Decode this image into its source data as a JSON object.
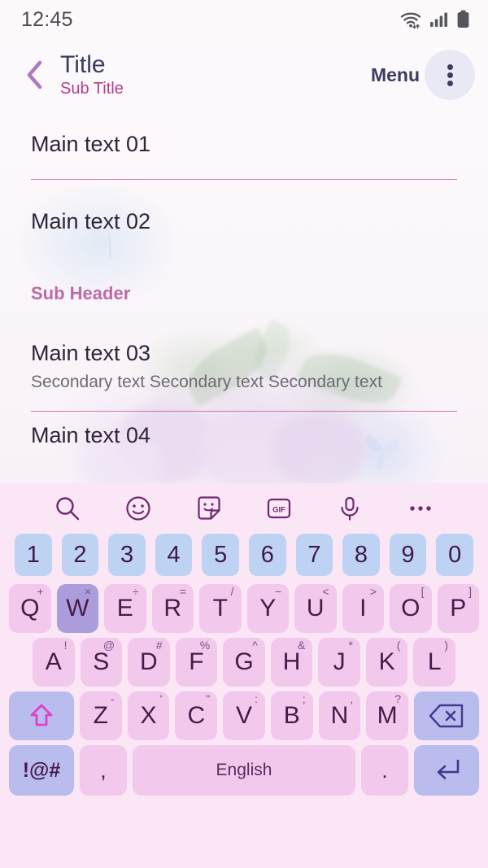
{
  "status_bar": {
    "time": "12:45",
    "icons": [
      "wifi-icon",
      "signal-icon",
      "battery-icon"
    ]
  },
  "app_bar": {
    "back_icon": "chevron-left-icon",
    "title": "Title",
    "subtitle": "Sub Title",
    "menu_label": "Menu",
    "overflow_icon": "more-vertical-icon"
  },
  "colors": {
    "accent_pink": "#b83a8c",
    "title_navy": "#3c3b63",
    "divider": "#b8519a",
    "sub_header": "#bd6aa8",
    "keyboard_bg": "#fbe6f6",
    "key_letter": "#f2c9ec",
    "key_number": "#bed2f4",
    "key_alt": "#b8bdee",
    "key_pressed": "#ab9cdc"
  },
  "list": {
    "rows": [
      {
        "main": "Main text 01",
        "secondary": ""
      },
      {
        "main": "Main text 02",
        "secondary": ""
      },
      {
        "main": "Main text 03",
        "secondary": "Secondary text Secondary text Secondary text"
      },
      {
        "main": "Main text 04",
        "secondary": ""
      }
    ],
    "sub_header": "Sub Header"
  },
  "keyboard": {
    "toolbar": [
      {
        "name": "search-icon",
        "label": ""
      },
      {
        "name": "emoji-icon",
        "label": ""
      },
      {
        "name": "sticker-icon",
        "label": ""
      },
      {
        "name": "gif-icon",
        "label": "GIF"
      },
      {
        "name": "microphone-icon",
        "label": ""
      },
      {
        "name": "more-horizontal-icon",
        "label": ""
      }
    ],
    "numbers": [
      "1",
      "2",
      "3",
      "4",
      "5",
      "6",
      "7",
      "8",
      "9",
      "0"
    ],
    "row1": [
      {
        "key": "Q",
        "sup": "+"
      },
      {
        "key": "W",
        "sup": "×",
        "pressed": true
      },
      {
        "key": "E",
        "sup": "÷"
      },
      {
        "key": "R",
        "sup": "="
      },
      {
        "key": "T",
        "sup": "/"
      },
      {
        "key": "Y",
        "sup": "−"
      },
      {
        "key": "U",
        "sup": "<"
      },
      {
        "key": "I",
        "sup": ">"
      },
      {
        "key": "O",
        "sup": "["
      },
      {
        "key": "P",
        "sup": "]"
      }
    ],
    "row2": [
      {
        "key": "A",
        "sup": "!"
      },
      {
        "key": "S",
        "sup": "@"
      },
      {
        "key": "D",
        "sup": "#"
      },
      {
        "key": "F",
        "sup": "%"
      },
      {
        "key": "G",
        "sup": "^"
      },
      {
        "key": "H",
        "sup": "&"
      },
      {
        "key": "J",
        "sup": "*"
      },
      {
        "key": "K",
        "sup": "("
      },
      {
        "key": "L",
        "sup": ")"
      }
    ],
    "row3": [
      {
        "key": "Z",
        "sup": "-"
      },
      {
        "key": "X",
        "sup": "'"
      },
      {
        "key": "C",
        "sup": "\""
      },
      {
        "key": "V",
        "sup": ":"
      },
      {
        "key": "B",
        "sup": ";"
      },
      {
        "key": "N",
        "sup": ","
      },
      {
        "key": "M",
        "sup": "?"
      }
    ],
    "shift_icon": "shift-arrow-icon",
    "backspace_icon": "backspace-icon",
    "symbols_label": "!@#",
    "comma_label": ",",
    "space_label": "English",
    "period_label": ".",
    "enter_icon": "enter-arrow-icon"
  }
}
